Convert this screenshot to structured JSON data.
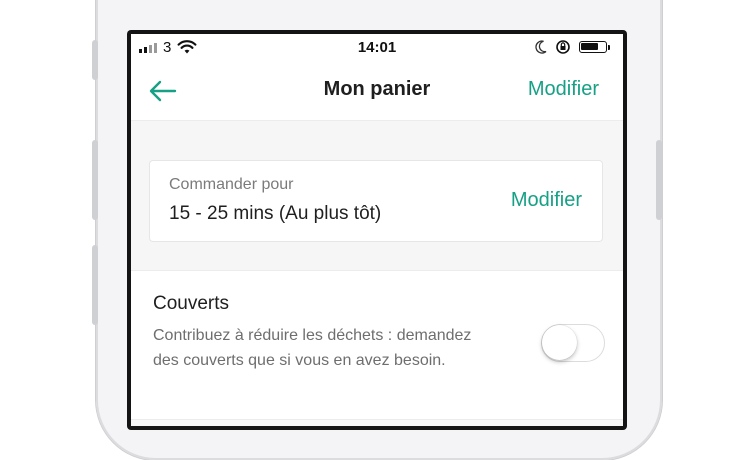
{
  "status_bar": {
    "carrier": "3",
    "time": "14:01",
    "icons": [
      "signal-icon",
      "wifi-icon",
      "moon-icon",
      "rotation-lock-icon",
      "battery-icon"
    ]
  },
  "header": {
    "back_icon": "arrow-left-icon",
    "title": "Mon panier",
    "action_label": "Modifier"
  },
  "order": {
    "label": "Commander pour",
    "value": "15 - 25 mins (Au plus tôt)",
    "action_label": "Modifier"
  },
  "cutlery": {
    "title": "Couverts",
    "description": "Contribuez à réduire les déchets : demandez des couverts que si vous en avez besoin.",
    "toggle_on": false
  },
  "colors": {
    "accent": "#16a085",
    "text_primary": "#1f1f1f",
    "text_secondary": "#7b7b7b",
    "background": "#f6f6f6"
  }
}
